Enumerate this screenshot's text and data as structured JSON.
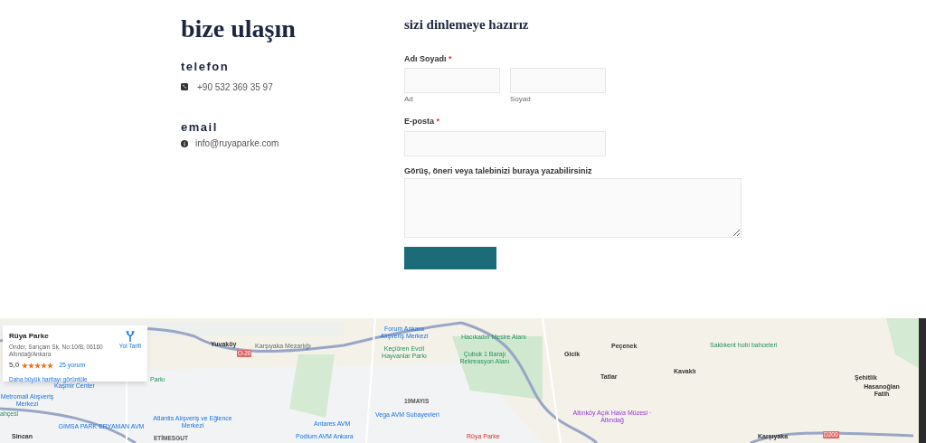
{
  "contact": {
    "title": "bize ulaşın",
    "phone_heading": "telefon",
    "phone": "+90 532 369 35 97",
    "email_heading": "email",
    "email": "info@ruyaparke.com"
  },
  "form": {
    "title": "sizi dinlemeye hazırız",
    "name_label": "Adı Soyadı",
    "required_mark": "*",
    "first_sublabel": "Ad",
    "last_sublabel": "Soyad",
    "email_label": "E-posta",
    "message_label": "Görüş, öneri veya talebinizi buraya yazabilirsiniz"
  },
  "map": {
    "card": {
      "title": "Rüya Parke",
      "address": "Önder, Sarıçam Sk. No:10/B, 06160 Altındağ/Ankara",
      "rating": "5,0",
      "stars": 5,
      "reviews": "25 yorum",
      "directions": "Yol Tarifi",
      "larger_map": "Daha büyük haritayı görüntüle"
    },
    "labels": [
      {
        "text": "Yuvaköy",
        "kind": "place"
      },
      {
        "text": "Karşıyaka Mezarlığı",
        "kind": "poi-gray"
      },
      {
        "text": "Forum Ankara Alışveriş Merkezi",
        "kind": "poi-blue"
      },
      {
        "text": "Keçiören Evcil Hayvanlar Parkı",
        "kind": "poi-green"
      },
      {
        "text": "Hacıkadın Mesire Alanı",
        "kind": "poi-green"
      },
      {
        "text": "Çubuk 1 Barajı Rekreasyon Alanı",
        "kind": "poi-green"
      },
      {
        "text": "Gicik",
        "kind": "place"
      },
      {
        "text": "Peçenek",
        "kind": "place"
      },
      {
        "text": "Tatlar",
        "kind": "place"
      },
      {
        "text": "Kavaklı",
        "kind": "place"
      },
      {
        "text": "Saklıkent hobi bahceleri",
        "kind": "poi-green"
      },
      {
        "text": "Şehitlik",
        "kind": "place"
      },
      {
        "text": "Hasanoğlan Fatih",
        "kind": "place"
      },
      {
        "text": "Altınköy Açık Hava Müzesi · Altındağ",
        "kind": "poi-purple"
      },
      {
        "text": "Rüya Parke",
        "kind": "poi-red"
      },
      {
        "text": "Karşıyaka",
        "kind": "place"
      },
      {
        "text": "Parkı",
        "kind": "poi-green"
      },
      {
        "text": "Kaşmir Center",
        "kind": "poi-blue"
      },
      {
        "text": "Metromall Alışveriş Merkezi",
        "kind": "poi-blue"
      },
      {
        "text": "ahçesi",
        "kind": "poi-green"
      },
      {
        "text": "Atlantis Alışveriş ve Eğlence Merkezi",
        "kind": "poi-blue"
      },
      {
        "text": "Sincan",
        "kind": "place"
      },
      {
        "text": "GİMSA PARK ERYAMAN AVM",
        "kind": "poi-blue"
      },
      {
        "text": "ETİMESGUT",
        "kind": "district"
      },
      {
        "text": "Antares AVM",
        "kind": "poi-blue"
      },
      {
        "text": "19MAYIS",
        "kind": "district"
      },
      {
        "text": "Vega AVM Subayevleri",
        "kind": "poi-blue"
      },
      {
        "text": "Podium AVM Ankara",
        "kind": "poi-blue"
      },
      {
        "text": "O-20",
        "kind": "road"
      },
      {
        "text": "D200",
        "kind": "road"
      }
    ]
  }
}
